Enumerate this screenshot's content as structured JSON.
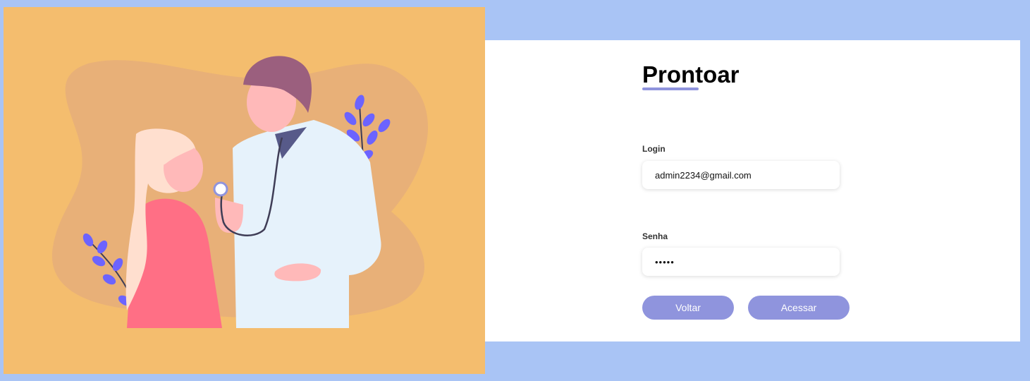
{
  "app": {
    "title": "Prontoar"
  },
  "form": {
    "login_label": "Login",
    "login_value": "admin2234@gmail.com",
    "senha_label": "Senha",
    "senha_value": "•••••",
    "voltar_label": "Voltar",
    "acessar_label": "Acessar"
  },
  "colors": {
    "page_background": "#a9c4f5",
    "illustration_background": "#f4bd6e",
    "accent": "#8f94dd",
    "panel_background": "#ffffff"
  },
  "illustration": {
    "description_icon": "doctor-patient-illustration"
  }
}
